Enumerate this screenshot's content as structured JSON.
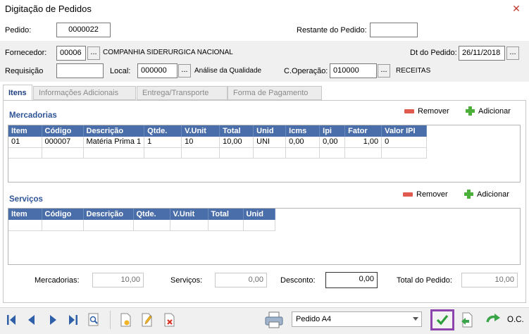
{
  "window": {
    "title": "Digitação de Pedidos"
  },
  "header": {
    "pedido_label": "Pedido:",
    "pedido_value": "0000022",
    "restante_label": "Restante do Pedido:",
    "restante_value": "",
    "fornecedor_label": "Fornecedor:",
    "fornecedor_code": "00006",
    "fornecedor_name": "COMPANHIA SIDERURGICA NACIONAL",
    "dt_label": "Dt do Pedido:",
    "dt_value": "26/11/2018",
    "requisicao_label": "Requisição",
    "requisicao_value": "",
    "local_label": "Local:",
    "local_code": "000000",
    "local_name": "Análise da Qualidade",
    "coperacao_label": "C.Operação:",
    "coperacao_code": "010000",
    "coperacao_name": "RECEITAS",
    "ellipsis": "..."
  },
  "tabs": [
    {
      "label": "Itens",
      "active": true
    },
    {
      "label": "Informações Adicionais",
      "active": false
    },
    {
      "label": "Entrega/Transporte",
      "active": false
    },
    {
      "label": "Forma de Pagamento",
      "active": false
    }
  ],
  "mercadorias": {
    "title": "Mercadorias",
    "remove_label": "Remover",
    "add_label": "Adicionar",
    "columns": [
      "Item",
      "Código",
      "Descrição",
      "Qtde.",
      "V.Unit",
      "Total",
      "Unid",
      "Icms",
      "Ipi",
      "Fator",
      "Valor IPI"
    ],
    "rows": [
      [
        "01",
        "000007",
        "Matéria Prima 1",
        "1",
        "10",
        "10,00",
        "UNI",
        "0,00",
        "0,00",
        "1,00",
        "0"
      ]
    ]
  },
  "servicos": {
    "title": "Serviços",
    "remove_label": "Remover",
    "add_label": "Adicionar",
    "columns": [
      "Item",
      "Código",
      "Descrição",
      "Qtde.",
      "V.Unit",
      "Total",
      "Unid"
    ]
  },
  "totals": {
    "mercadorias_label": "Mercadorias:",
    "mercadorias_value": "10,00",
    "servicos_label": "Serviços:",
    "servicos_value": "0,00",
    "desconto_label": "Desconto:",
    "desconto_value": "0,00",
    "total_label": "Total do Pedido:",
    "total_value": "10,00"
  },
  "footer": {
    "report_select": "Pedido A4",
    "oc_label": "O.C."
  },
  "icons": {
    "nav": [
      "first-record-icon",
      "previous-record-icon",
      "next-record-icon",
      "last-record-icon",
      "search-record-icon"
    ],
    "actions": [
      "new-document-icon",
      "edit-pencil-icon",
      "delete-document-icon",
      "printer-icon",
      "confirm-check-icon",
      "export-document-icon",
      "oc-arrow-icon"
    ]
  },
  "colors": {
    "grid_header": "#4a6ea9",
    "section_title": "#2f5597",
    "confirm_border": "#8e44ad"
  }
}
